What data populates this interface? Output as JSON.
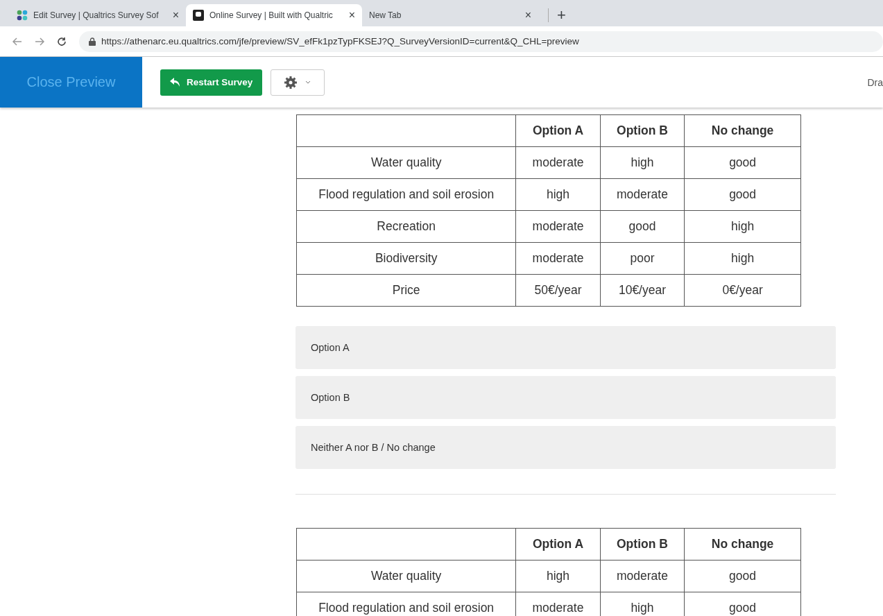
{
  "browser": {
    "tabs": [
      {
        "title": "Edit Survey | Qualtrics Survey Sof",
        "selected": false,
        "close": "×"
      },
      {
        "title": "Online Survey | Built with Qualtric",
        "selected": true,
        "close": "×"
      },
      {
        "title": "New Tab",
        "selected": false,
        "close": "×"
      }
    ],
    "new_tab": "+",
    "url": "https://athenarc.eu.qualtrics.com/jfe/preview/SV_efFk1pzTypFKSEJ?Q_SurveyVersionID=current&Q_CHL=preview"
  },
  "toolbar": {
    "close_preview": "Close Preview",
    "restart": "Restart Survey",
    "right_text": "Dra"
  },
  "blocks": [
    {
      "kind": "table",
      "columns": [
        "",
        "Option A",
        "Option B",
        "No change"
      ],
      "rows": [
        [
          "Water quality",
          "moderate",
          "high",
          "good"
        ],
        [
          "Flood regulation and soil erosion",
          "high",
          "moderate",
          "good"
        ],
        [
          "Recreation",
          "moderate",
          "good",
          "high"
        ],
        [
          "Biodiversity",
          "moderate",
          "poor",
          "high"
        ],
        [
          "Price",
          "50€/year",
          "10€/year",
          "0€/year"
        ]
      ]
    },
    {
      "kind": "choices",
      "options": [
        {
          "label": "Option A",
          "selected": false
        },
        {
          "label": "Option B",
          "selected": false
        },
        {
          "label": "Neither A nor B / No change",
          "selected": false
        }
      ]
    },
    {
      "kind": "divider"
    },
    {
      "kind": "table",
      "columns": [
        "",
        "Option A",
        "Option B",
        "No change"
      ],
      "rows": [
        [
          "Water quality",
          "high",
          "moderate",
          "good"
        ],
        [
          "Flood regulation and soil erosion",
          "moderate",
          "high",
          "good"
        ]
      ]
    }
  ]
}
